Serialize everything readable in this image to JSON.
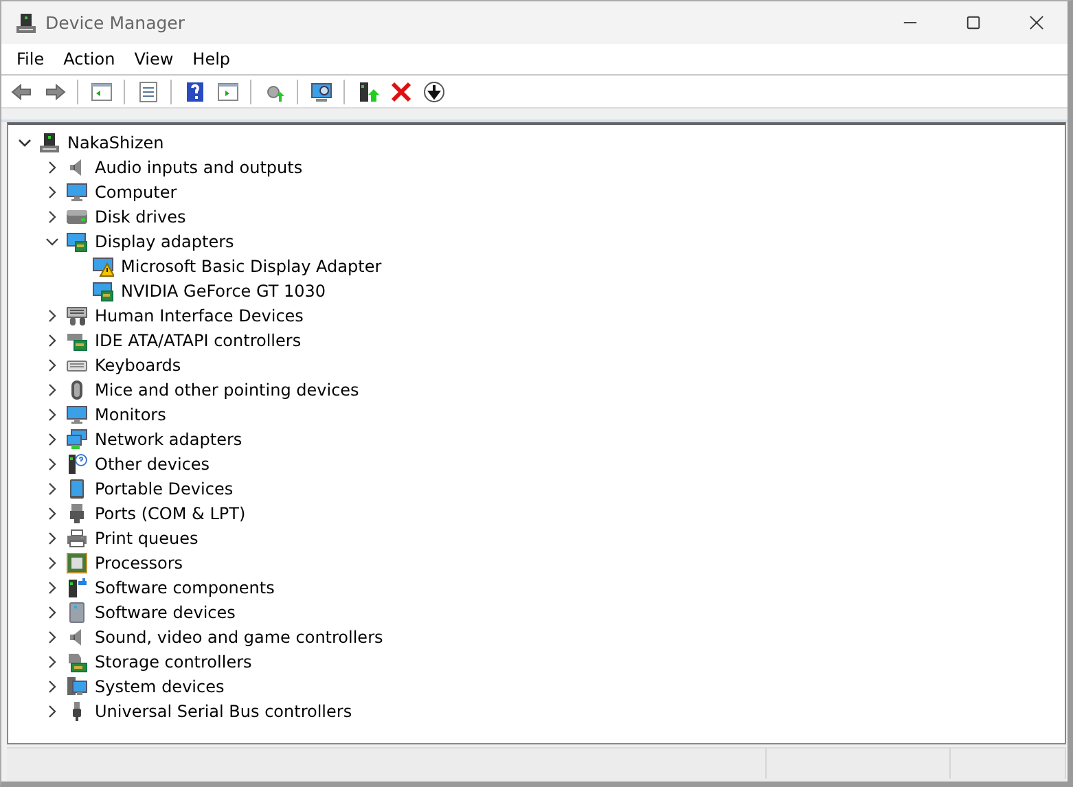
{
  "window": {
    "title": "Device Manager"
  },
  "menu": [
    "File",
    "Action",
    "View",
    "Help"
  ],
  "tree": {
    "label": "NakaShizen",
    "expanded": true,
    "children": [
      {
        "label": "Audio inputs and outputs",
        "expanded": false
      },
      {
        "label": "Computer",
        "expanded": false
      },
      {
        "label": "Disk drives",
        "expanded": false
      },
      {
        "label": "Display adapters",
        "expanded": true,
        "children": [
          {
            "label": "Microsoft Basic Display Adapter",
            "warning": true
          },
          {
            "label": "NVIDIA GeForce GT 1030",
            "warning": false
          }
        ]
      },
      {
        "label": "Human Interface Devices",
        "expanded": false
      },
      {
        "label": "IDE ATA/ATAPI controllers",
        "expanded": false
      },
      {
        "label": "Keyboards",
        "expanded": false
      },
      {
        "label": "Mice and other pointing devices",
        "expanded": false
      },
      {
        "label": "Monitors",
        "expanded": false
      },
      {
        "label": "Network adapters",
        "expanded": false
      },
      {
        "label": "Other devices",
        "expanded": false
      },
      {
        "label": "Portable Devices",
        "expanded": false
      },
      {
        "label": "Ports (COM & LPT)",
        "expanded": false
      },
      {
        "label": "Print queues",
        "expanded": false
      },
      {
        "label": "Processors",
        "expanded": false
      },
      {
        "label": "Software components",
        "expanded": false
      },
      {
        "label": "Software devices",
        "expanded": false
      },
      {
        "label": "Sound, video and game controllers",
        "expanded": false
      },
      {
        "label": "Storage controllers",
        "expanded": false
      },
      {
        "label": "System devices",
        "expanded": false
      },
      {
        "label": "Universal Serial Bus controllers",
        "expanded": false
      }
    ]
  }
}
